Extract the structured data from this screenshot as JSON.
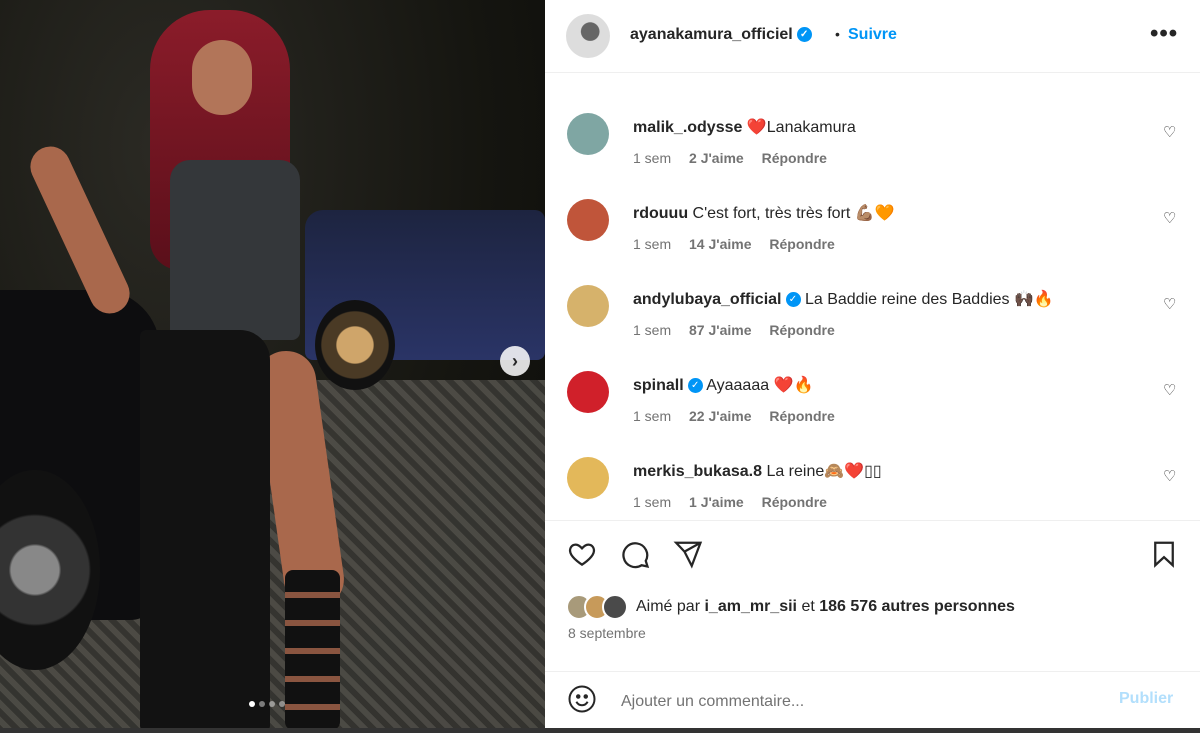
{
  "post": {
    "author": "ayanakamura_officiel",
    "separator": "•",
    "follow_label": "Suivre",
    "more_label": "•••",
    "next_label": "›",
    "carousel": {
      "count": 4,
      "active": 0
    }
  },
  "comments": [
    {
      "user": "malik_.odysse",
      "verified": false,
      "text": "❤️Lanakamura",
      "age": "1 sem",
      "likes": "2 J'aime",
      "reply": "Répondre",
      "avatar_color": "#7fa6a3"
    },
    {
      "user": "rdouuu",
      "verified": false,
      "text": "C'est fort, très très fort 💪🏽🧡",
      "age": "1 sem",
      "likes": "14 J'aime",
      "reply": "Répondre",
      "avatar_color": "#c0553a"
    },
    {
      "user": "andylubaya_official",
      "verified": true,
      "text": "La Baddie reine des Baddies 🙌🏿🔥",
      "age": "1 sem",
      "likes": "87 J'aime",
      "reply": "Répondre",
      "avatar_color": "#d6b26b"
    },
    {
      "user": "spinall",
      "verified": true,
      "text": "Ayaaaaa ❤️🔥",
      "age": "1 sem",
      "likes": "22 J'aime",
      "reply": "Répondre",
      "avatar_color": "#d0202a"
    },
    {
      "user": "merkis_bukasa.8",
      "verified": false,
      "text": "La reine🙈❤️▯▯",
      "age": "1 sem",
      "likes": "1 J'aime",
      "reply": "Répondre",
      "avatar_color": "#e3b85a"
    }
  ],
  "likes": {
    "prefix": "Aimé par",
    "user": "i_am_mr_sii",
    "middle": "et",
    "count_text": "186 576 autres personnes"
  },
  "date": "8 septembre",
  "add_comment": {
    "placeholder": "Ajouter un commentaire...",
    "publish_label": "Publier"
  },
  "colors": {
    "accent": "#0095f6",
    "publish_disabled": "#b2dffc",
    "meta_text": "#737373"
  },
  "icons": {
    "like": "heart-icon",
    "comment": "comment-icon",
    "share": "paper-plane-icon",
    "save": "bookmark-icon",
    "emoji": "smiley-icon",
    "more": "more-dots-icon",
    "verified": "verified-badge-icon"
  }
}
